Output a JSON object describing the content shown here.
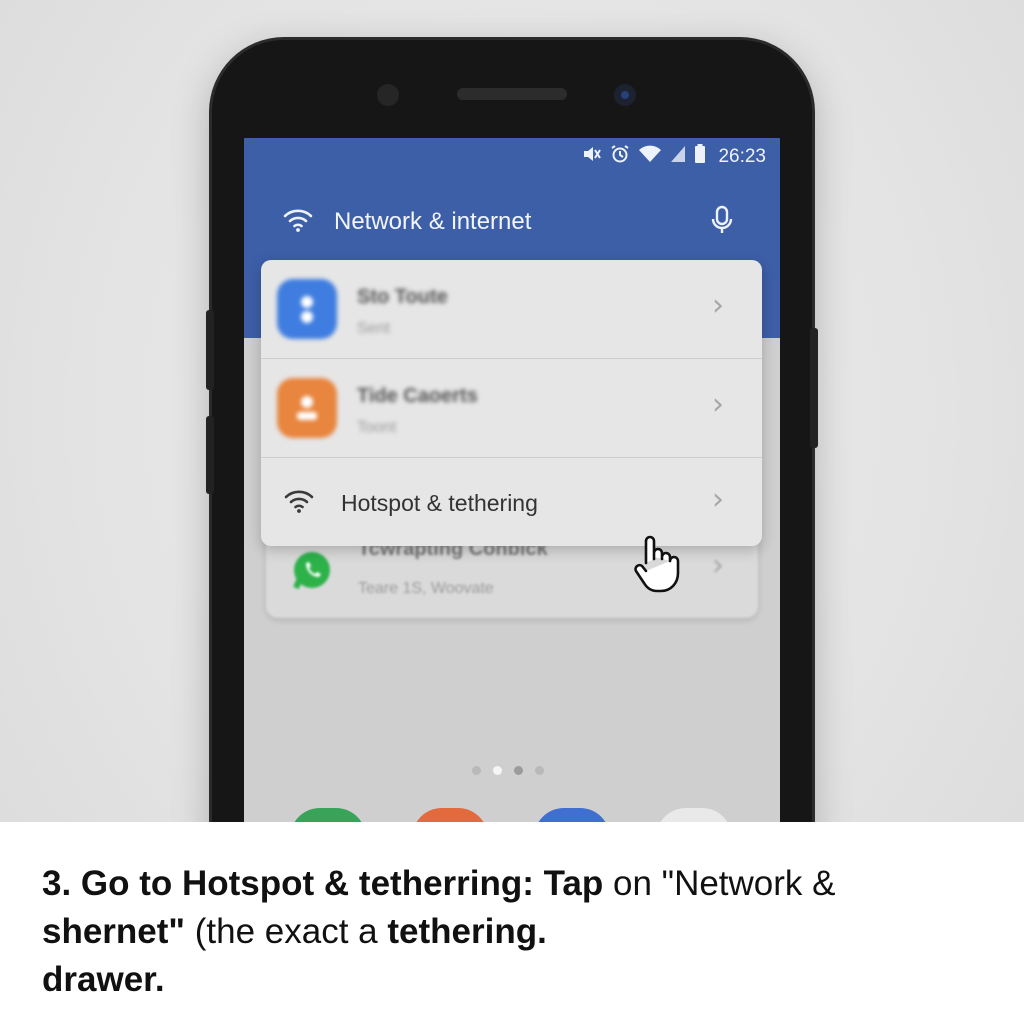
{
  "status_bar": {
    "time": "26:23",
    "icons": [
      "mute-icon",
      "alarm-icon",
      "wifi-icon",
      "signal-icon",
      "battery-icon"
    ]
  },
  "app_bar": {
    "title": "Network & internet",
    "leading_icon": "wifi-icon",
    "trailing_icon": "mic-icon",
    "color": "#3d5fa8"
  },
  "list": {
    "items": [
      {
        "title": "Sto Toute",
        "subtitle": "Sent",
        "icon": "app-icon-blue",
        "color": "#3f7de0"
      },
      {
        "title": "Tide Caoerts",
        "subtitle": "Toont",
        "icon": "app-icon-orange",
        "color": "#e8853e"
      },
      {
        "title": "Hotspot & tethering",
        "icon": "wifi-icon"
      }
    ],
    "background_item": {
      "title": "Tcwrapting Conbick",
      "subtitle": "Teare 1S, Woovate",
      "icon": "whatsapp-icon",
      "color": "#2db24a"
    }
  },
  "page_indicator": {
    "count": 4,
    "active": 2
  },
  "dock": {
    "colors": [
      "#3aa35a",
      "#e26a3c",
      "#3f6fd0",
      "#e9e9e9"
    ]
  },
  "caption": {
    "p1_bold": "3. Go to Hotspot & tetherring: Tap",
    "p2": " on \"Network & ",
    "p3_bold": "shernet\"",
    "p4": " (the exact a ",
    "p5_bold": "tethering.",
    "p6_bold": "drawer."
  }
}
